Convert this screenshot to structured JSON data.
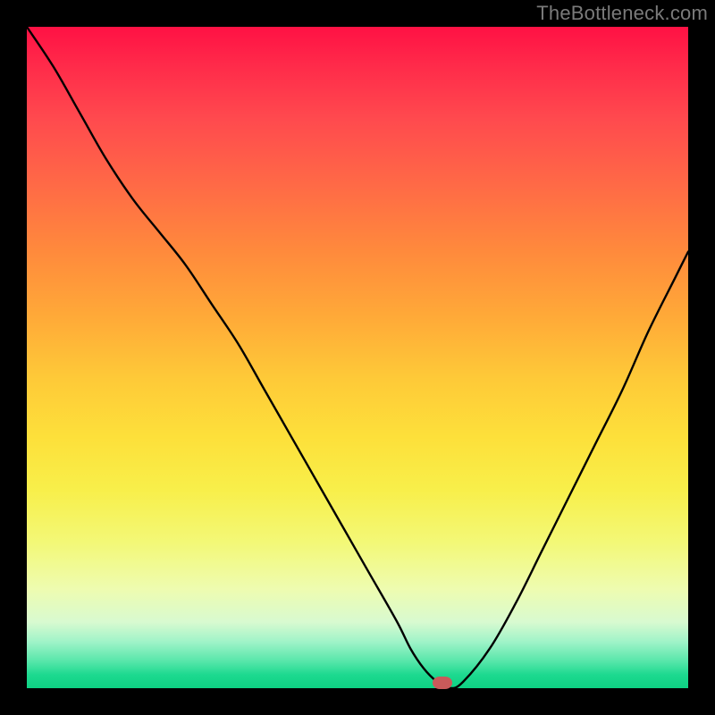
{
  "watermark": "TheBottleneck.com",
  "marker": {
    "x_pct": 62.8,
    "y_pct": 99.2
  },
  "chart_data": {
    "type": "line",
    "title": "",
    "xlabel": "",
    "ylabel": "",
    "xlim": [
      0,
      100
    ],
    "ylim": [
      0,
      100
    ],
    "x": [
      0,
      4,
      8,
      12,
      16,
      20,
      24,
      28,
      32,
      36,
      40,
      44,
      48,
      52,
      56,
      58,
      60,
      62,
      64,
      66,
      70,
      74,
      78,
      82,
      86,
      90,
      94,
      98,
      100
    ],
    "values": [
      100,
      94,
      87,
      80,
      74,
      69,
      64,
      58,
      52,
      45,
      38,
      31,
      24,
      17,
      10,
      6,
      3,
      1,
      0,
      1,
      6,
      13,
      21,
      29,
      37,
      45,
      54,
      62,
      66
    ],
    "annotations": [
      {
        "type": "marker",
        "x": 62.8,
        "y": 0.8,
        "color": "#c95a5a",
        "shape": "pill"
      }
    ],
    "background_gradient": {
      "direction": "vertical",
      "stops": [
        {
          "pos": 0,
          "color": "#ff1144"
        },
        {
          "pos": 50,
          "color": "#ffd23a"
        },
        {
          "pos": 85,
          "color": "#eefcb0"
        },
        {
          "pos": 100,
          "color": "#0ed183"
        }
      ]
    }
  }
}
